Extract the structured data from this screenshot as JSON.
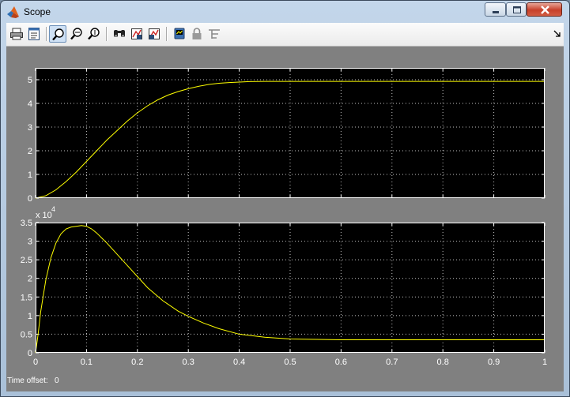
{
  "window": {
    "title": "Scope"
  },
  "toolbar": {
    "buttons": [
      {
        "name": "print-icon",
        "tooltip": "Print"
      },
      {
        "name": "parameters-icon",
        "tooltip": "Parameters"
      },
      {
        "name": "zoom-icon",
        "tooltip": "Zoom",
        "pressed": true
      },
      {
        "name": "zoom-x-icon",
        "tooltip": "Zoom X-axis"
      },
      {
        "name": "zoom-y-icon",
        "tooltip": "Zoom Y-axis"
      },
      {
        "name": "autoscale-icon",
        "tooltip": "Autoscale"
      },
      {
        "name": "save-axes-settings-icon",
        "tooltip": "Save axes settings"
      },
      {
        "name": "restore-axes-settings-icon",
        "tooltip": "Restore axes settings"
      },
      {
        "name": "floating-scope-icon",
        "tooltip": "Floating scope"
      },
      {
        "name": "lock-axes-icon",
        "tooltip": "Lock axes selection"
      },
      {
        "name": "signal-selection-icon",
        "tooltip": "Signal selection"
      }
    ]
  },
  "status": {
    "label": "Time offset:",
    "value": "0"
  },
  "colors": {
    "axes_background": "#000000",
    "figure_background": "#808080",
    "trace": "#ffff00",
    "grid": "#ffffff",
    "tick_label": "#ffffff"
  },
  "chart_data": [
    {
      "type": "line",
      "title": "",
      "xlabel": "",
      "ylabel": "",
      "xlim": [
        0,
        1
      ],
      "ylim": [
        0,
        5.5
      ],
      "grid": true,
      "x_ticks": [
        0,
        0.1,
        0.2,
        0.3,
        0.4,
        0.5,
        0.6,
        0.7,
        0.8,
        0.9,
        1
      ],
      "y_ticks": [
        0,
        1,
        2,
        3,
        4,
        5
      ],
      "y_tick_labels": [
        "0",
        "1",
        "2",
        "3",
        "4",
        "5"
      ],
      "x_tick_labels": [],
      "series": [
        {
          "x": [
            0,
            0.02,
            0.04,
            0.06,
            0.08,
            0.1,
            0.12,
            0.14,
            0.16,
            0.18,
            0.2,
            0.22,
            0.24,
            0.26,
            0.28,
            0.3,
            0.32,
            0.34,
            0.36,
            0.38,
            0.4,
            0.42,
            0.45,
            0.5,
            0.6,
            0.7,
            0.8,
            0.9,
            1
          ],
          "y": [
            0,
            0.1,
            0.35,
            0.7,
            1.1,
            1.55,
            2.0,
            2.45,
            2.85,
            3.25,
            3.6,
            3.9,
            4.15,
            4.35,
            4.5,
            4.62,
            4.72,
            4.8,
            4.85,
            4.88,
            4.9,
            4.92,
            4.93,
            4.93,
            4.93,
            4.93,
            4.93,
            4.93,
            4.93
          ]
        }
      ]
    },
    {
      "type": "line",
      "title": "",
      "xlabel": "",
      "ylabel": "",
      "multiplier_base": "x 10",
      "multiplier_exponent": "4",
      "xlim": [
        0,
        1
      ],
      "ylim": [
        0,
        3.5
      ],
      "grid": true,
      "x_ticks": [
        0,
        0.1,
        0.2,
        0.3,
        0.4,
        0.5,
        0.6,
        0.7,
        0.8,
        0.9,
        1
      ],
      "x_tick_labels": [
        "0",
        "0.1",
        "0.2",
        "0.3",
        "0.4",
        "0.5",
        "0.6",
        "0.7",
        "0.8",
        "0.9",
        "1"
      ],
      "y_ticks": [
        0,
        0.5,
        1,
        1.5,
        2,
        2.5,
        3,
        3.5
      ],
      "y_tick_labels": [
        "0",
        "0.5",
        "1",
        "1.5",
        "2",
        "2.5",
        "3",
        "3.5"
      ],
      "series": [
        {
          "x": [
            0,
            0.005,
            0.01,
            0.02,
            0.03,
            0.04,
            0.05,
            0.06,
            0.07,
            0.08,
            0.09,
            0.1,
            0.11,
            0.12,
            0.14,
            0.16,
            0.18,
            0.2,
            0.22,
            0.25,
            0.28,
            0.3,
            0.33,
            0.36,
            0.4,
            0.45,
            0.5,
            0.55,
            0.6,
            0.7,
            0.8,
            0.9,
            1
          ],
          "y": [
            0,
            0.5,
            1.1,
            1.95,
            2.55,
            2.95,
            3.2,
            3.33,
            3.38,
            3.4,
            3.42,
            3.4,
            3.33,
            3.22,
            2.95,
            2.65,
            2.35,
            2.05,
            1.75,
            1.4,
            1.12,
            0.98,
            0.8,
            0.65,
            0.5,
            0.42,
            0.37,
            0.36,
            0.35,
            0.35,
            0.35,
            0.35,
            0.35
          ]
        }
      ]
    }
  ]
}
